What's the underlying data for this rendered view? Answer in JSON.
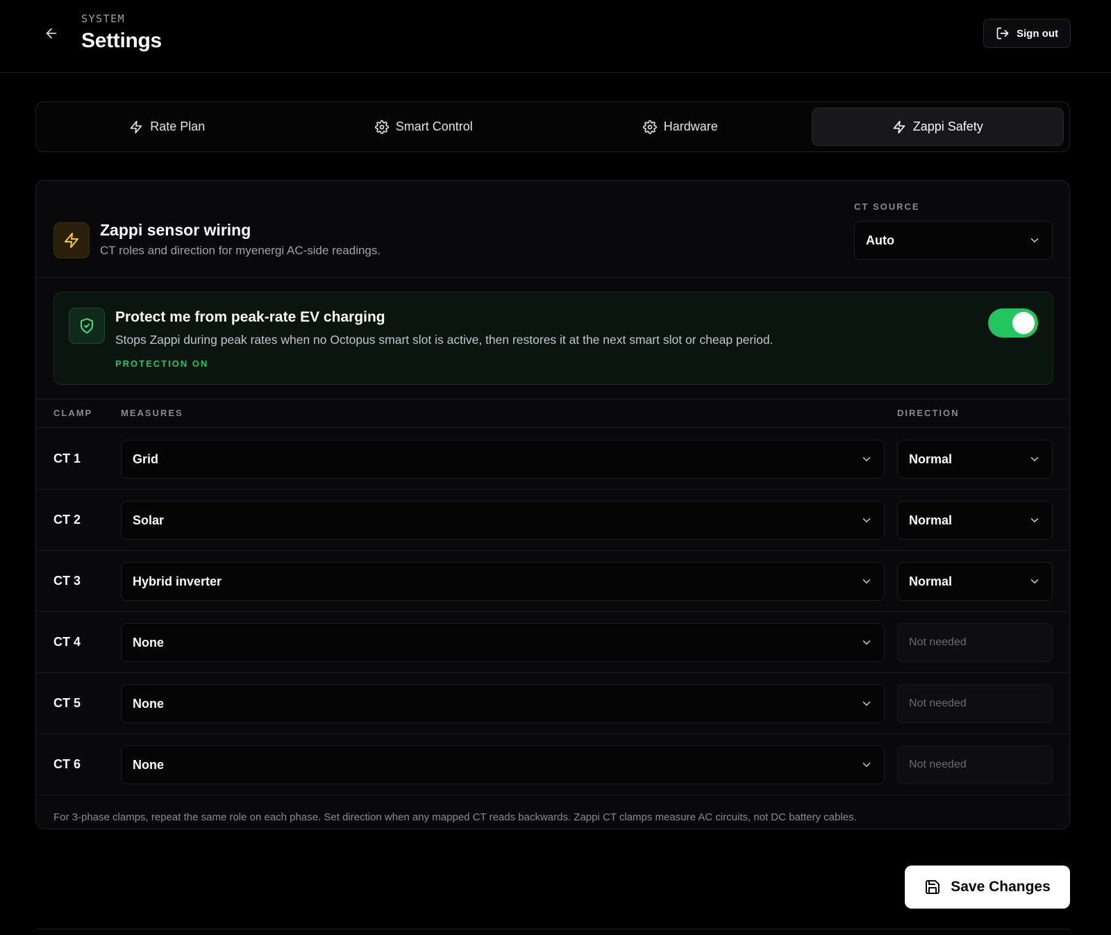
{
  "header": {
    "eyebrow": "SYSTEM",
    "title": "Settings",
    "sign_out_label": "Sign out"
  },
  "tabs": [
    {
      "label": "Rate Plan",
      "icon": "zap-icon",
      "active": false
    },
    {
      "label": "Smart Control",
      "icon": "gear-icon",
      "active": false
    },
    {
      "label": "Hardware",
      "icon": "gear-icon",
      "active": false
    },
    {
      "label": "Zappi Safety",
      "icon": "zap-icon",
      "active": true
    }
  ],
  "card": {
    "title": "Zappi sensor wiring",
    "subtitle": "CT roles and direction for myenergi AC-side readings.",
    "ct_source_label": "CT SOURCE",
    "ct_source_value": "Auto"
  },
  "protection": {
    "title": "Protect me from peak-rate EV charging",
    "description": "Stops Zappi during peak rates when no Octopus smart slot is active, then restores it at the next smart slot or cheap period.",
    "status": "PROTECTION ON",
    "enabled": true
  },
  "table": {
    "headers": {
      "clamp": "CLAMP",
      "measures": "MEASURES",
      "direction": "DIRECTION"
    },
    "rows": [
      {
        "clamp": "CT 1",
        "measures": "Grid",
        "direction": "Normal"
      },
      {
        "clamp": "CT 2",
        "measures": "Solar",
        "direction": "Normal"
      },
      {
        "clamp": "CT 3",
        "measures": "Hybrid inverter",
        "direction": "Normal"
      },
      {
        "clamp": "CT 4",
        "measures": "None",
        "direction": "Not needed"
      },
      {
        "clamp": "CT 5",
        "measures": "None",
        "direction": "Not needed"
      },
      {
        "clamp": "CT 6",
        "measures": "None",
        "direction": "Not needed"
      }
    ]
  },
  "footnote": "For 3-phase clamps, repeat the same role on each phase. Set direction when any mapped CT reads backwards. Zappi CT clamps measure AC circuits, not DC battery cables.",
  "save_label": "Save Changes",
  "colors": {
    "background": "#000000",
    "accent_green": "#22c55e",
    "zap_yellow": "#facc15"
  }
}
